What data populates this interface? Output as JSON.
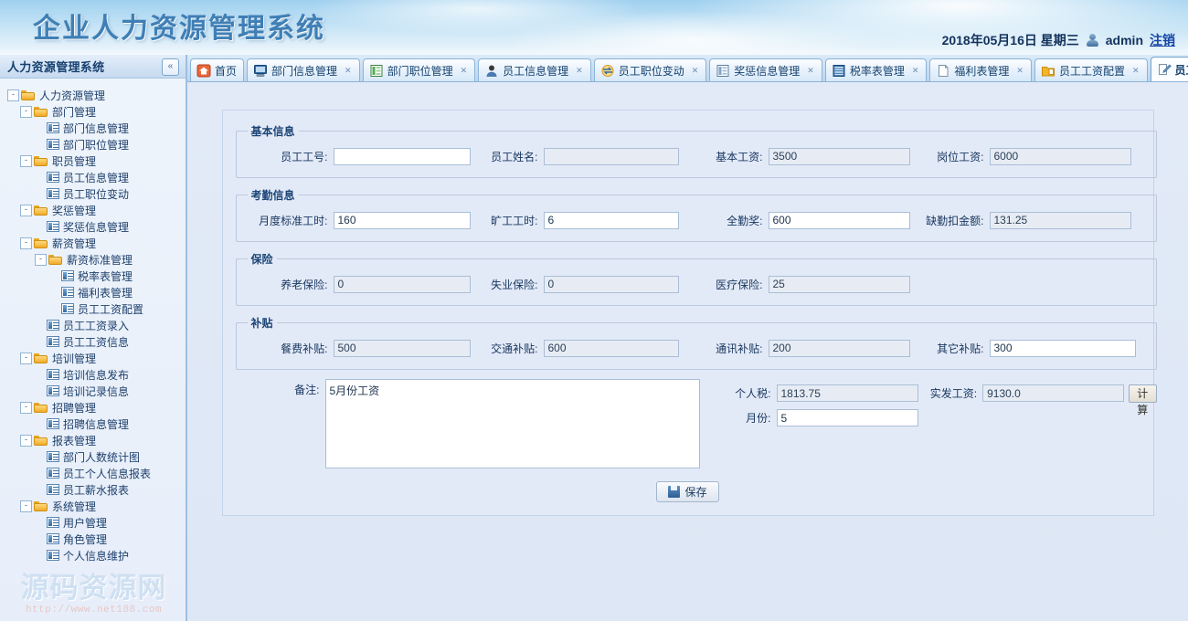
{
  "header": {
    "title": "企业人力资源管理系统",
    "date": "2018年05月16日 星期三",
    "user_icon": "user-icon",
    "username": "admin",
    "logout": "注销"
  },
  "sidebar": {
    "title": "人力资源管理系统",
    "collapse_icon": "«",
    "tree": [
      {
        "label": "人力资源管理",
        "level": 1,
        "type": "folder",
        "expander": "-"
      },
      {
        "label": "部门管理",
        "level": 2,
        "type": "folder",
        "expander": "-"
      },
      {
        "label": "部门信息管理",
        "level": 3,
        "type": "leaf",
        "expander": ""
      },
      {
        "label": "部门职位管理",
        "level": 3,
        "type": "leaf",
        "expander": ""
      },
      {
        "label": "职员管理",
        "level": 2,
        "type": "folder",
        "expander": "-"
      },
      {
        "label": "员工信息管理",
        "level": 3,
        "type": "leaf",
        "expander": ""
      },
      {
        "label": "员工职位变动",
        "level": 3,
        "type": "leaf",
        "expander": ""
      },
      {
        "label": "奖惩管理",
        "level": 2,
        "type": "folder",
        "expander": "-"
      },
      {
        "label": "奖惩信息管理",
        "level": 3,
        "type": "leaf",
        "expander": ""
      },
      {
        "label": "薪资管理",
        "level": 2,
        "type": "folder",
        "expander": "-"
      },
      {
        "label": "薪资标准管理",
        "level": 3,
        "type": "folder",
        "expander": "-"
      },
      {
        "label": "税率表管理",
        "level": 4,
        "type": "leaf",
        "expander": ""
      },
      {
        "label": "福利表管理",
        "level": 4,
        "type": "leaf",
        "expander": ""
      },
      {
        "label": "员工工资配置",
        "level": 4,
        "type": "leaf",
        "expander": ""
      },
      {
        "label": "员工工资录入",
        "level": 3,
        "type": "leaf",
        "expander": ""
      },
      {
        "label": "员工工资信息",
        "level": 3,
        "type": "leaf",
        "expander": ""
      },
      {
        "label": "培训管理",
        "level": 2,
        "type": "folder",
        "expander": "-"
      },
      {
        "label": "培训信息发布",
        "level": 3,
        "type": "leaf",
        "expander": ""
      },
      {
        "label": "培训记录信息",
        "level": 3,
        "type": "leaf",
        "expander": ""
      },
      {
        "label": "招聘管理",
        "level": 2,
        "type": "folder",
        "expander": "-"
      },
      {
        "label": "招聘信息管理",
        "level": 3,
        "type": "leaf",
        "expander": ""
      },
      {
        "label": "报表管理",
        "level": 2,
        "type": "folder",
        "expander": "-"
      },
      {
        "label": "部门人数统计图",
        "level": 3,
        "type": "leaf",
        "expander": ""
      },
      {
        "label": "员工个人信息报表",
        "level": 3,
        "type": "leaf",
        "expander": ""
      },
      {
        "label": "员工薪水报表",
        "level": 3,
        "type": "leaf",
        "expander": ""
      },
      {
        "label": "系统管理",
        "level": 2,
        "type": "folder",
        "expander": "-"
      },
      {
        "label": "用户管理",
        "level": 3,
        "type": "leaf",
        "expander": ""
      },
      {
        "label": "角色管理",
        "level": 3,
        "type": "leaf",
        "expander": ""
      },
      {
        "label": "个人信息维护",
        "level": 3,
        "type": "leaf",
        "expander": ""
      }
    ],
    "watermark": {
      "text": "源码资源网",
      "url": "http://www.net188.com"
    }
  },
  "tabs": [
    {
      "label": "首页",
      "icon": "home-icon",
      "closable": false,
      "active": false
    },
    {
      "label": "部门信息管理",
      "icon": "monitor-icon",
      "closable": true,
      "active": false
    },
    {
      "label": "部门职位管理",
      "icon": "grid-green-icon",
      "closable": true,
      "active": false
    },
    {
      "label": "员工信息管理",
      "icon": "person-icon",
      "closable": true,
      "active": false
    },
    {
      "label": "员工职位变动",
      "icon": "swap-icon",
      "closable": true,
      "active": false
    },
    {
      "label": "奖惩信息管理",
      "icon": "list-icon",
      "closable": true,
      "active": false
    },
    {
      "label": "税率表管理",
      "icon": "table-blue-icon",
      "closable": true,
      "active": false
    },
    {
      "label": "福利表管理",
      "icon": "page-icon",
      "closable": true,
      "active": false
    },
    {
      "label": "员工工资配置",
      "icon": "folder-yellow-icon",
      "closable": true,
      "active": false
    },
    {
      "label": "员工工资录入",
      "icon": "pencil-edit-icon",
      "closable": true,
      "active": true
    }
  ],
  "form": {
    "groups": {
      "basic": {
        "legend": "基本信息",
        "fields": [
          {
            "label": "员工工号:",
            "value": "",
            "readonly": false
          },
          {
            "label": "员工姓名:",
            "value": "",
            "readonly": true
          },
          {
            "label": "基本工资:",
            "value": "3500",
            "readonly": true
          },
          {
            "label": "岗位工资:",
            "value": "6000",
            "readonly": true
          }
        ]
      },
      "attendance": {
        "legend": "考勤信息",
        "fields": [
          {
            "label": "月度标准工时:",
            "value": "160",
            "readonly": false
          },
          {
            "label": "旷工工时:",
            "value": "6",
            "readonly": false
          },
          {
            "label": "全勤奖:",
            "value": "600",
            "readonly": false
          },
          {
            "label": "缺勤扣金额:",
            "value": "131.25",
            "readonly": true
          }
        ]
      },
      "insurance": {
        "legend": "保险",
        "fields": [
          {
            "label": "养老保险:",
            "value": "0",
            "readonly": true
          },
          {
            "label": "失业保险:",
            "value": "0",
            "readonly": true
          },
          {
            "label": "医疗保险:",
            "value": "25",
            "readonly": true
          }
        ]
      },
      "subsidy": {
        "legend": "补贴",
        "fields": [
          {
            "label": "餐费补贴:",
            "value": "500",
            "readonly": true
          },
          {
            "label": "交通补贴:",
            "value": "600",
            "readonly": true
          },
          {
            "label": "通讯补贴:",
            "value": "200",
            "readonly": true
          },
          {
            "label": "其它补贴:",
            "value": "300",
            "readonly": false
          }
        ]
      }
    },
    "remark": {
      "label": "备注:",
      "value": "5月份工资"
    },
    "tax": {
      "label": "个人税:",
      "value": "1813.75"
    },
    "net_salary": {
      "label": "实发工资:",
      "value": "9130.0"
    },
    "month": {
      "label": "月份:",
      "value": "5"
    },
    "calc_button": "计算",
    "save_button": "保存",
    "save_icon": "floppy-save-icon"
  }
}
